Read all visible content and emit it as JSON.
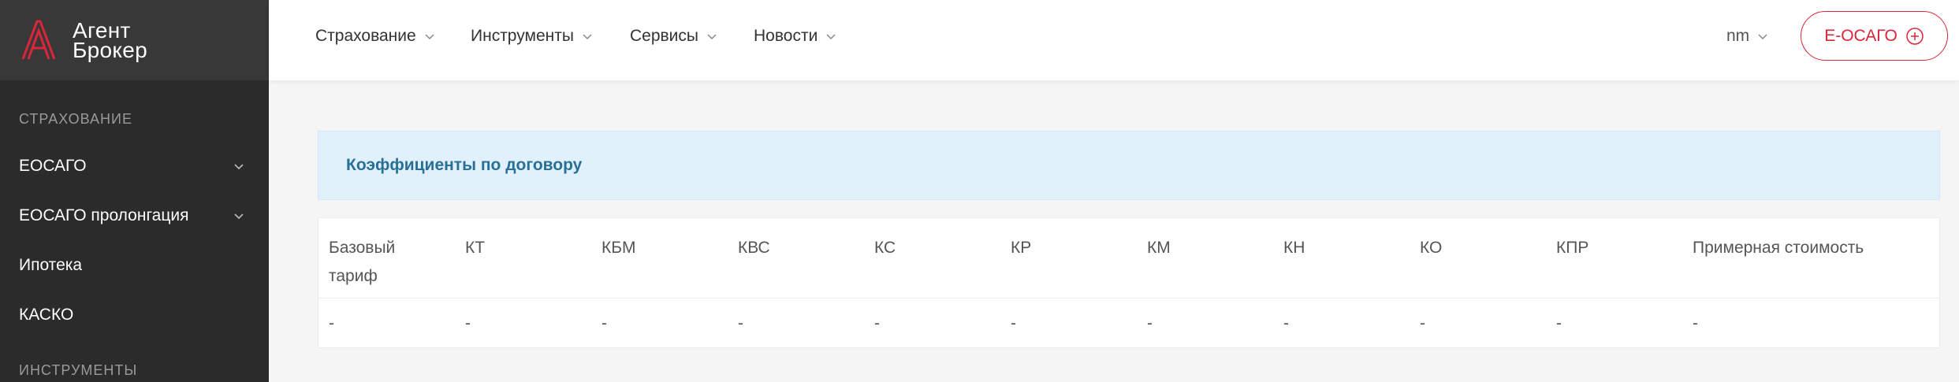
{
  "brand": {
    "line1": "Агент",
    "line2": "Брокер",
    "accent": "#d9263a"
  },
  "sidebar": {
    "sections": [
      {
        "title": "СТРАХОВАНИЕ"
      },
      {
        "title": "ИНСТРУМЕНТЫ"
      }
    ],
    "items": [
      {
        "label": "ЕОСАГО",
        "has_submenu": true
      },
      {
        "label": "ЕОСАГО пролонгация",
        "has_submenu": true
      },
      {
        "label": "Ипотека",
        "has_submenu": false
      },
      {
        "label": "КАСКО",
        "has_submenu": false
      }
    ]
  },
  "header": {
    "nav": [
      {
        "label": "Страхование"
      },
      {
        "label": "Инструменты"
      },
      {
        "label": "Сервисы"
      },
      {
        "label": "Новости"
      }
    ],
    "user": "nm",
    "cta_label": "Е-ОСАГО"
  },
  "coefficients": {
    "title": "Коэффициенты по договору",
    "columns": [
      "Базовый тариф",
      "КТ",
      "КБМ",
      "КВС",
      "КС",
      "КР",
      "КМ",
      "КН",
      "КО",
      "КПР",
      "Примерная стоимость"
    ],
    "values": [
      "-",
      "-",
      "-",
      "-",
      "-",
      "-",
      "-",
      "-",
      "-",
      "-",
      "-"
    ]
  }
}
